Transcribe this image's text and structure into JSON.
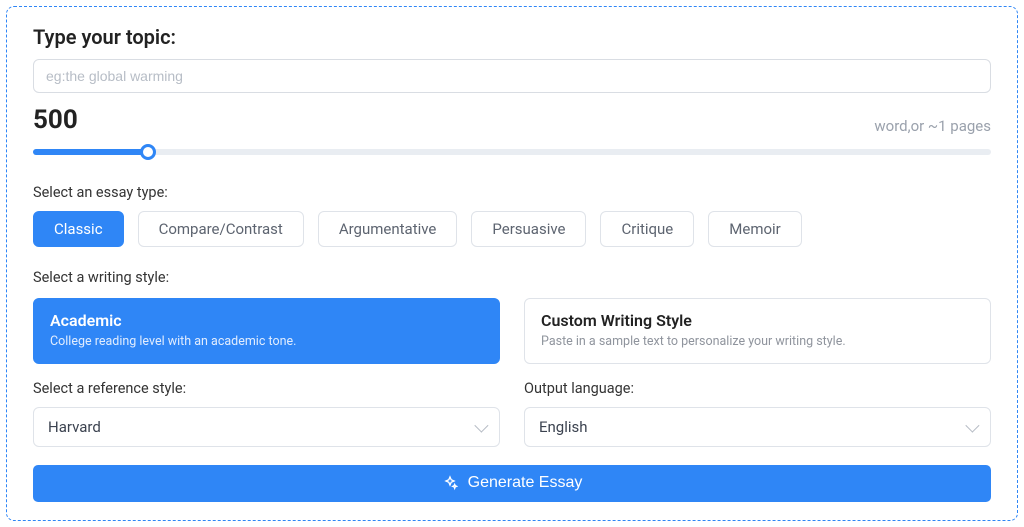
{
  "topic": {
    "label": "Type your topic:",
    "placeholder": "eg:the global warming",
    "value": ""
  },
  "word_count": {
    "value": "500",
    "note": "word,or ~1 pages",
    "slider_percent": 12
  },
  "essay_type": {
    "label": "Select an essay type:",
    "options": [
      "Classic",
      "Compare/Contrast",
      "Argumentative",
      "Persuasive",
      "Critique",
      "Memoir"
    ],
    "selected_index": 0
  },
  "writing_style": {
    "label": "Select a writing style:",
    "options": [
      {
        "title": "Academic",
        "sub": "College reading level with an academic tone."
      },
      {
        "title": "Custom Writing Style",
        "sub": "Paste in a sample text to personalize your writing style."
      }
    ],
    "selected_index": 0
  },
  "reference_style": {
    "label": "Select a reference style:",
    "value": "Harvard"
  },
  "output_language": {
    "label": "Output language:",
    "value": "English"
  },
  "generate_label": "Generate Essay",
  "colors": {
    "accent": "#2f86f6"
  }
}
